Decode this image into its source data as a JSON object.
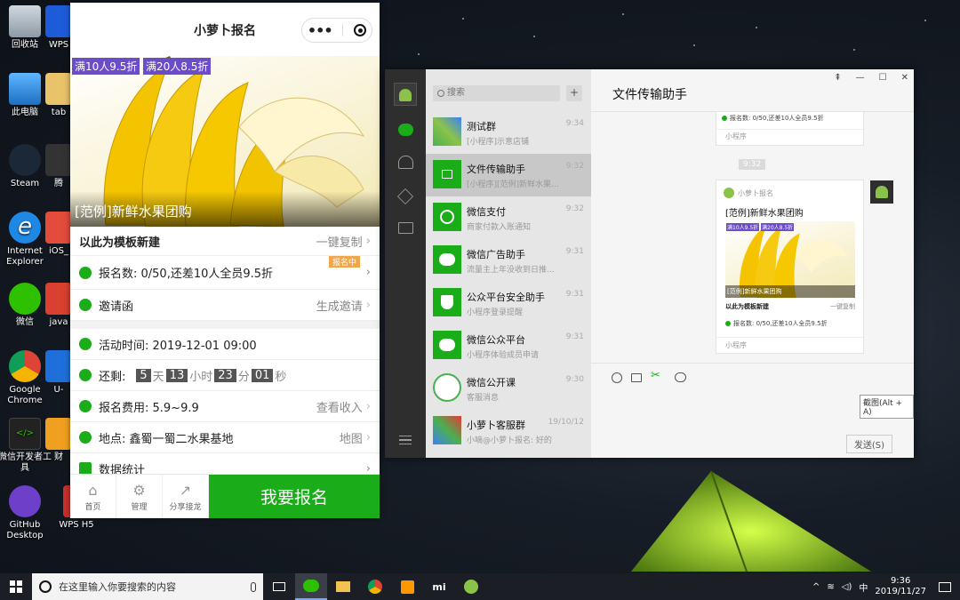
{
  "desktop": {
    "left_icons": [
      {
        "label": "回收站"
      },
      {
        "label": "此电脑"
      },
      {
        "label": "Steam"
      },
      {
        "label": "Internet Explorer"
      },
      {
        "label": "微信"
      },
      {
        "label": "Google Chrome"
      },
      {
        "label": "微信开发者工具"
      },
      {
        "label": "GitHub Desktop"
      }
    ],
    "second_col_labels": [
      "WPS",
      "tab",
      "腾",
      "iOS_",
      "java",
      "U-",
      "财",
      "WPS H5"
    ]
  },
  "miniprogram": {
    "title": "小萝卜报名",
    "badges": [
      "满10人9.5折",
      "满20人8.5折"
    ],
    "hero_title": "[范例]新鲜水果团购",
    "template_row": {
      "label": "以此为模板新建",
      "action": "一键复制"
    },
    "signup_row": {
      "label": "报名数: 0/50,还差10人全员9.5折",
      "status": "报名中"
    },
    "invite_row": {
      "label": "邀请函",
      "action": "生成邀请"
    },
    "time_row": {
      "label": "活动时间: 2019-12-01 09:00"
    },
    "countdown": {
      "prefix": "还剩:",
      "days": "5",
      "days_unit": "天",
      "hours": "13",
      "hours_unit": "小时",
      "minutes": "23",
      "minutes_unit": "分",
      "seconds": "01",
      "seconds_unit": "秒"
    },
    "fee_row": {
      "label": "报名费用: 5.9~9.9",
      "action": "查看收入"
    },
    "location_row": {
      "label": "地点: 鑫蜀一蜀二水果基地",
      "action": "地图"
    },
    "stats_row": {
      "label": "数据统计"
    },
    "bottom": {
      "home": "首页",
      "manage": "管理",
      "share": "分享接龙",
      "signup": "我要报名"
    }
  },
  "wechat": {
    "search_placeholder": "搜索",
    "chats": [
      {
        "name": "测试群",
        "msg": "[小程序]示意店铺",
        "time": "9:34"
      },
      {
        "name": "文件传输助手",
        "msg": "[小程序][范例]新鲜水果...",
        "time": "9:32"
      },
      {
        "name": "微信支付",
        "msg": "商家付款入账通知",
        "time": "9:32"
      },
      {
        "name": "微信广告助手",
        "msg": "流量主上年没收到日推...",
        "time": "9:31"
      },
      {
        "name": "公众平台安全助手",
        "msg": "小程序登录提醒",
        "time": "9:31"
      },
      {
        "name": "微信公众平台",
        "msg": "小程序体验成员申请",
        "time": "9:31"
      },
      {
        "name": "微信公开课",
        "msg": "客服消息",
        "time": "9:30"
      },
      {
        "name": "小萝卜客服群",
        "msg": "小嘀@小萝卜报名: 好的",
        "time": "19/10/12"
      }
    ],
    "chat_title": "文件传输助手",
    "window_controls": [
      "⇞",
      "—",
      "☐",
      "✕"
    ],
    "card_top": {
      "line": "报名数: 0/50,还差10人全员9.5折",
      "source": "小程序"
    },
    "timestamp": "9:32",
    "card": {
      "app": "小萝卜报名",
      "title": "[范例]新鲜水果团购",
      "badges": [
        "满10人9.5折",
        "满20人8.5折"
      ],
      "img_title": "[范例]新鲜水果团购",
      "template": "以此为模板新建",
      "copy": "一键复制",
      "signup": "报名数: 0/50,还差10人全员9.5折",
      "source": "小程序"
    },
    "tooltip": "截图(Alt + A)",
    "send": "发送(S)"
  },
  "taskbar": {
    "search_placeholder": "在这里输入你要搜索的内容",
    "ime": "中",
    "time": "9:36",
    "date": "2019/11/27"
  },
  "colors": {
    "wechat_green": "#1aad19",
    "badge_purple": "#6b4cc9"
  }
}
